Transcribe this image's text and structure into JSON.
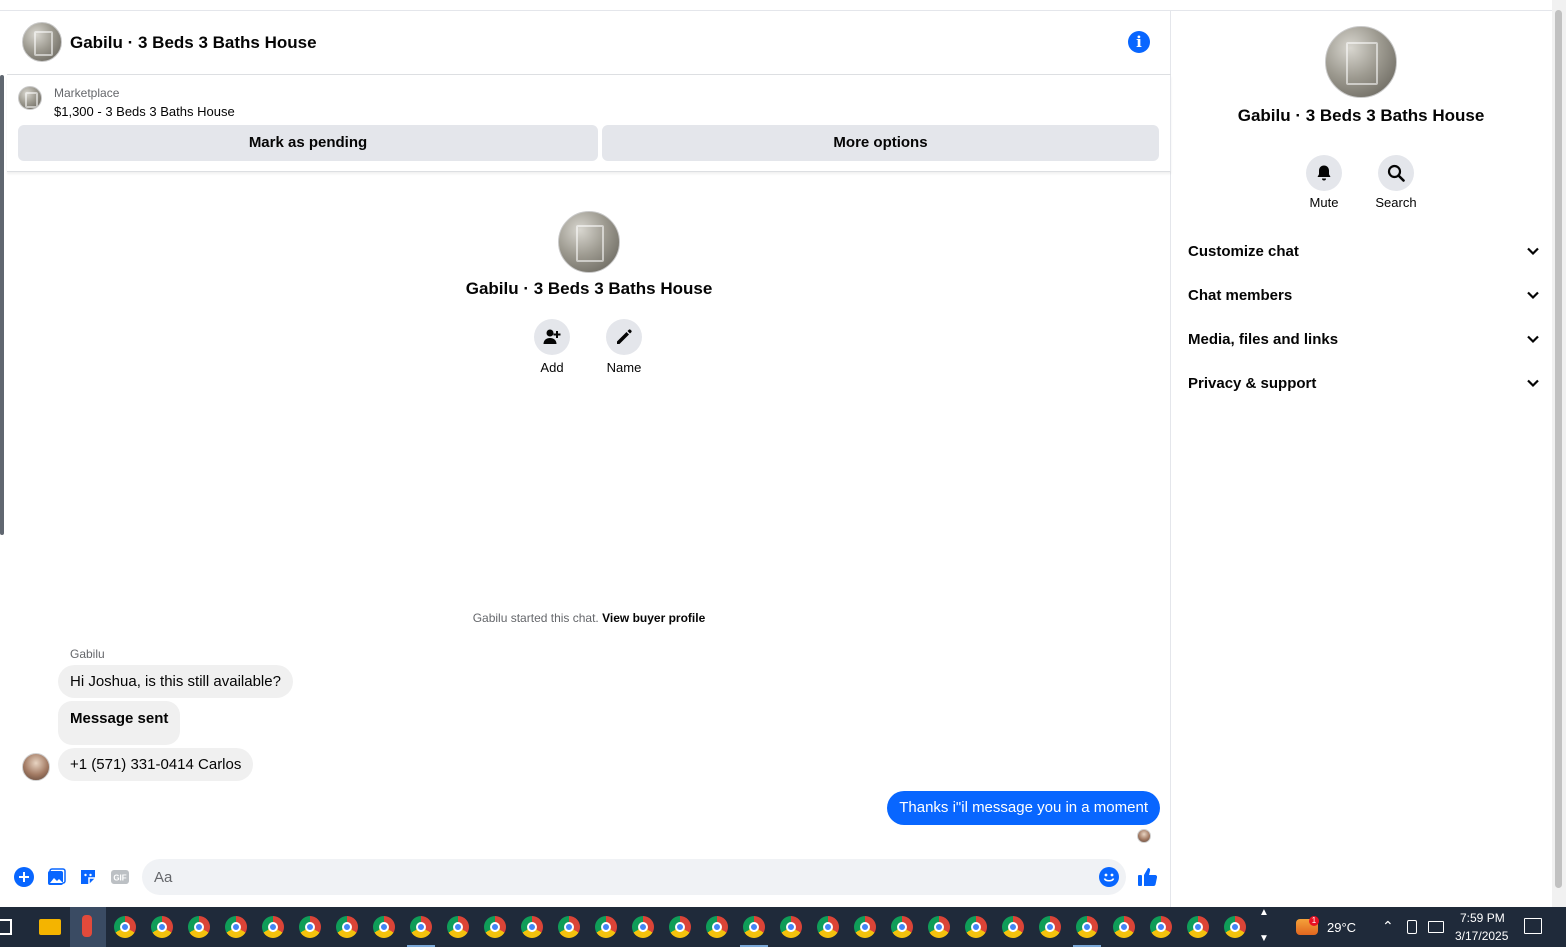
{
  "header": {
    "title": "Gabilu · 3 Beds 3 Baths House"
  },
  "marketplace": {
    "label": "Marketplace",
    "listing": "$1,300 - 3 Beds 3 Baths House",
    "mark_pending": "Mark as pending",
    "more_options": "More options"
  },
  "intro": {
    "title": "Gabilu · 3 Beds 3 Baths House",
    "add_label": "Add",
    "name_label": "Name"
  },
  "thread": {
    "started_text": "Gabilu started this chat.",
    "view_profile": "View buyer profile",
    "sender": "Gabilu",
    "messages_in": [
      "Hi Joshua, is this still available?",
      "Message sent",
      "+1 (571) 331-0414 Carlos"
    ],
    "message_out": "Thanks i\"il message you in a moment"
  },
  "composer": {
    "placeholder": "Aa"
  },
  "sidebar": {
    "title": "Gabilu · 3 Beds 3 Baths House",
    "mute_label": "Mute",
    "search_label": "Search",
    "sections": [
      "Customize chat",
      "Chat members",
      "Media, files and links",
      "Privacy & support"
    ]
  },
  "taskbar": {
    "temperature": "29°C",
    "weather_badge": "1",
    "time": "7:59 PM",
    "date": "3/17/2025"
  },
  "colors": {
    "accent": "#0866ff",
    "bubble_in": "#f0f0f0",
    "button_bg": "#e4e6eb"
  }
}
